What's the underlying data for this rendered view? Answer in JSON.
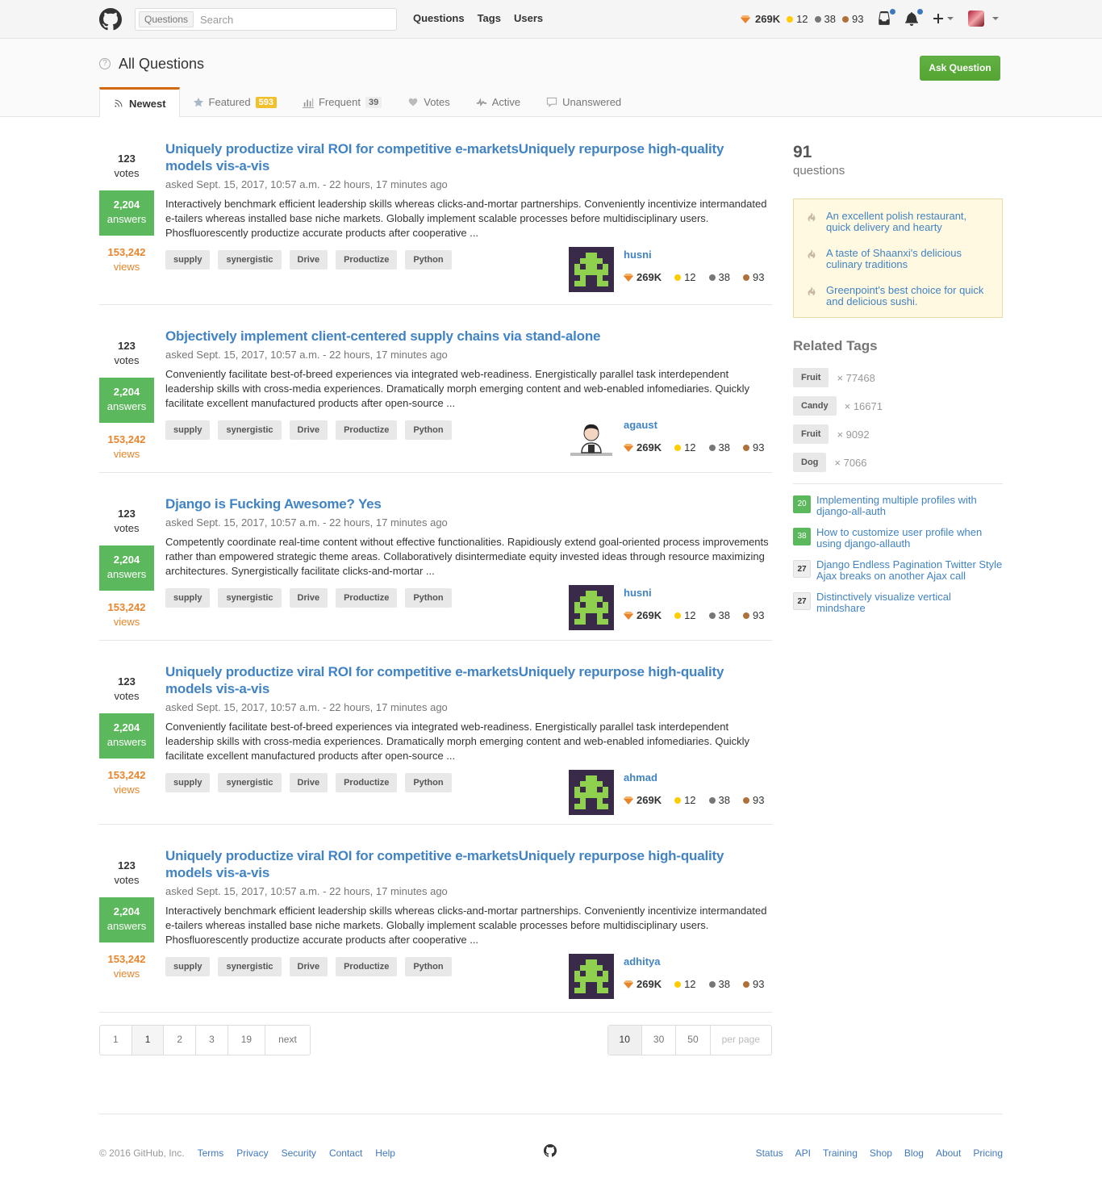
{
  "header": {
    "search_scope": "Questions",
    "search_placeholder": "Search",
    "nav": [
      "Questions",
      "Tags",
      "Users"
    ],
    "reputation": "269K",
    "gold": "12",
    "silver": "38",
    "bronze": "93"
  },
  "subheader": {
    "title": "All Questions",
    "ask_button": "Ask Question",
    "tabs": [
      {
        "label": "Newest",
        "badge": ""
      },
      {
        "label": "Featured",
        "badge": "593"
      },
      {
        "label": "Frequent",
        "badge": "39"
      },
      {
        "label": "Votes",
        "badge": ""
      },
      {
        "label": "Active",
        "badge": ""
      },
      {
        "label": "Unanswered",
        "badge": ""
      }
    ]
  },
  "questions": [
    {
      "votes": "123",
      "votes_label": "votes",
      "answers": "2,204",
      "answers_label": "answers",
      "views": "153,242",
      "views_label": "views",
      "title": "Uniquely productize viral ROI for competitive e-marketsUniquely repurpose high-quality models vis-a-vis",
      "meta": "asked Sept. 15, 2017, 10:57 a.m. - 22 hours, 17 minutes ago",
      "excerpt": "Interactively benchmark efficient leadership skills whereas clicks-and-mortar partnerships. Conveniently incentivize intermandated e-tailers whereas installed base niche markets. Globally implement scalable processes before multidisciplinary users. Phosfluorescently productize accurate products after cooperative ...",
      "tags": [
        "supply",
        "synergistic",
        "Drive",
        "Productize",
        "Python"
      ],
      "user": "husni",
      "rep": "269K",
      "gold": "12",
      "silver": "38",
      "bronze": "93",
      "avatar": "invader"
    },
    {
      "votes": "123",
      "votes_label": "votes",
      "answers": "2,204",
      "answers_label": "answers",
      "views": "153,242",
      "views_label": "views",
      "title": "Objectively implement client-centered supply chains via stand-alone",
      "meta": "asked Sept. 15, 2017, 10:57 a.m. - 22 hours, 17 minutes ago",
      "excerpt": "Conveniently facilitate best-of-breed experiences via integrated web-readiness. Energistically parallel task interdependent leadership skills with cross-media experiences. Dramatically morph emerging content and web-enabled infomediaries. Quickly facilitate excellent manufactured products after open-source ...",
      "tags": [
        "supply",
        "synergistic",
        "Drive",
        "Productize",
        "Python"
      ],
      "user": "agaust",
      "rep": "269K",
      "gold": "12",
      "silver": "38",
      "bronze": "93",
      "avatar": "person"
    },
    {
      "votes": "123",
      "votes_label": "votes",
      "answers": "2,204",
      "answers_label": "answers",
      "views": "153,242",
      "views_label": "views",
      "title": "Django is Fucking Awesome? Yes",
      "meta": "asked Sept. 15, 2017, 10:57 a.m. - 22 hours, 17 minutes ago",
      "excerpt": "Competently coordinate real-time content without effective functionalities. Rapidiously extend goal-oriented process improvements rather than empowered strategic theme areas. Collaboratively disintermediate equity invested ideas through resource maximizing architectures. Synergistically facilitate clicks-and-mortar ...",
      "tags": [
        "supply",
        "synergistic",
        "Drive",
        "Productize",
        "Python"
      ],
      "user": "husni",
      "rep": "269K",
      "gold": "12",
      "silver": "38",
      "bronze": "93",
      "avatar": "invader"
    },
    {
      "votes": "123",
      "votes_label": "votes",
      "answers": "2,204",
      "answers_label": "answers",
      "views": "153,242",
      "views_label": "views",
      "title": "Uniquely productize viral ROI for competitive e-marketsUniquely repurpose high-quality models vis-a-vis",
      "meta": "asked Sept. 15, 2017, 10:57 a.m. - 22 hours, 17 minutes ago",
      "excerpt": "Conveniently facilitate best-of-breed experiences via integrated web-readiness. Energistically parallel task interdependent leadership skills with cross-media experiences. Dramatically morph emerging content and web-enabled infomediaries. Quickly facilitate excellent manufactured products after open-source ...",
      "tags": [
        "supply",
        "synergistic",
        "Drive",
        "Productize",
        "Python"
      ],
      "user": "ahmad",
      "rep": "269K",
      "gold": "12",
      "silver": "38",
      "bronze": "93",
      "avatar": "invader"
    },
    {
      "votes": "123",
      "votes_label": "votes",
      "answers": "2,204",
      "answers_label": "answers",
      "views": "153,242",
      "views_label": "views",
      "title": "Uniquely productize viral ROI for competitive e-marketsUniquely repurpose high-quality models vis-a-vis",
      "meta": "asked Sept. 15, 2017, 10:57 a.m. - 22 hours, 17 minutes ago",
      "excerpt": "Interactively benchmark efficient leadership skills whereas clicks-and-mortar partnerships. Conveniently incentivize intermandated e-tailers whereas installed base niche markets. Globally implement scalable processes before multidisciplinary users. Phosfluorescently productize accurate products after cooperative ...",
      "tags": [
        "supply",
        "synergistic",
        "Drive",
        "Productize",
        "Python"
      ],
      "user": "adhitya",
      "rep": "269K",
      "gold": "12",
      "silver": "38",
      "bronze": "93",
      "avatar": "invader"
    }
  ],
  "pagination": {
    "pages": [
      "1",
      "1",
      "2",
      "3",
      "19",
      "next"
    ],
    "per_page": [
      "10",
      "30",
      "50",
      "per page"
    ]
  },
  "sidebar": {
    "count": "91",
    "count_label": "questions",
    "hot": [
      "An excellent polish restaurant, quick delivery and hearty",
      "A taste of Shaanxi's delicious culinary traditions",
      "Greenpoint's best choice for quick and delicious sushi."
    ],
    "related_title": "Related Tags",
    "related_tags": [
      {
        "name": "Fruit",
        "count": "× 77468"
      },
      {
        "name": "Candy",
        "count": "× 16671"
      },
      {
        "name": "Fruit",
        "count": "× 9092"
      },
      {
        "name": "Dog",
        "count": "× 7066"
      }
    ],
    "linked": [
      {
        "badge": "20",
        "style": "green",
        "text": "Implementing multiple profiles with django-all-auth"
      },
      {
        "badge": "38",
        "style": "green",
        "text": "How to customize user profile when using django-allauth"
      },
      {
        "badge": "27",
        "style": "plain",
        "text": "Django Endless Pagination Twitter Style Ajax breaks on another Ajax call"
      },
      {
        "badge": "27",
        "style": "plain",
        "text": "Distinctively visualize vertical mindshare"
      }
    ]
  },
  "footer": {
    "copyright": "© 2016 GitHub, Inc.",
    "left_links": [
      "Terms",
      "Privacy",
      "Security",
      "Contact",
      "Help"
    ],
    "right_links": [
      "Status",
      "API",
      "Training",
      "Shop",
      "Blog",
      "About",
      "Pricing"
    ]
  }
}
